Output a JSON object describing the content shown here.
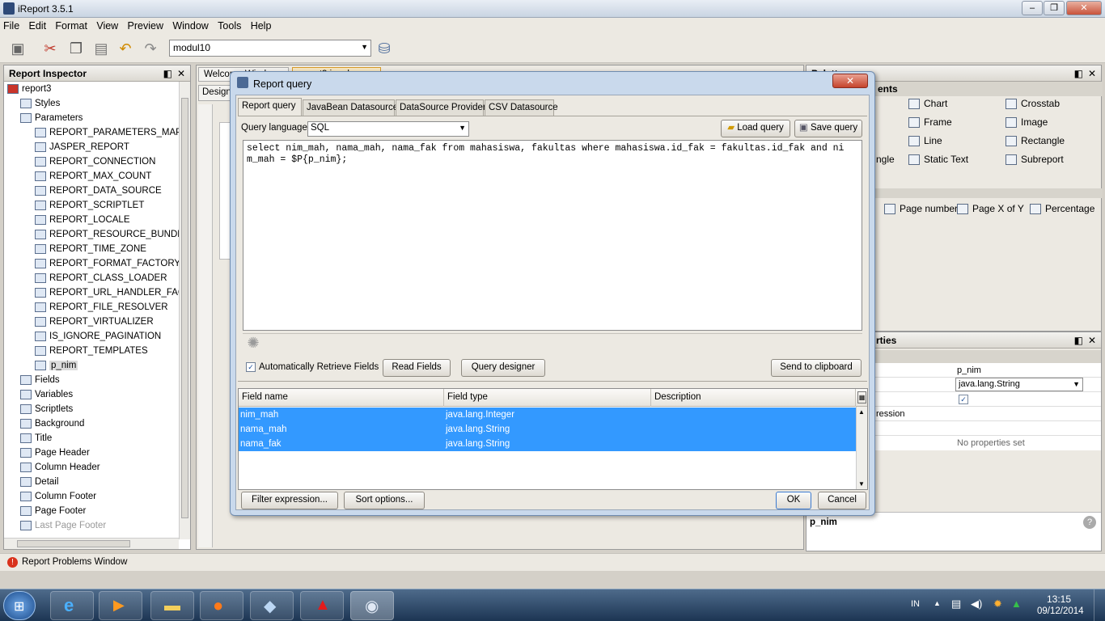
{
  "window": {
    "title": "iReport 3.5.1",
    "min_icon": "minimize-icon",
    "max_icon": "maximize-icon",
    "close_label": "✕"
  },
  "menu": [
    "File",
    "Edit",
    "Format",
    "View",
    "Preview",
    "Window",
    "Tools",
    "Help"
  ],
  "toolbar": {
    "connection": "modul10"
  },
  "inspector": {
    "title": "Report Inspector",
    "root": "report3",
    "items": [
      "Styles",
      "Parameters"
    ],
    "params": [
      "REPORT_PARAMETERS_MAP",
      "JASPER_REPORT",
      "REPORT_CONNECTION",
      "REPORT_MAX_COUNT",
      "REPORT_DATA_SOURCE",
      "REPORT_SCRIPTLET",
      "REPORT_LOCALE",
      "REPORT_RESOURCE_BUNDLE",
      "REPORT_TIME_ZONE",
      "REPORT_FORMAT_FACTORY",
      "REPORT_CLASS_LOADER",
      "REPORT_URL_HANDLER_FACTO",
      "REPORT_FILE_RESOLVER",
      "REPORT_VIRTUALIZER",
      "IS_IGNORE_PAGINATION",
      "REPORT_TEMPLATES",
      "p_nim"
    ],
    "sections": [
      "Fields",
      "Variables",
      "Scriptlets",
      "Background",
      "Title",
      "Page Header",
      "Column Header",
      "Detail",
      "Column Footer",
      "Page Footer",
      "Last Page Footer"
    ]
  },
  "editor": {
    "tab_welcome": "Welcome Window",
    "tab_report": "report3.jrxml",
    "design_tab": "Design"
  },
  "palette": {
    "title": "Palette",
    "section": "ents",
    "items": [
      "Chart",
      "Crosstab",
      "Frame",
      "Image",
      "Line",
      "Rectangle",
      "ngle",
      "Static Text",
      "Subreport",
      "Page number",
      "Page X of Y",
      "Percentage"
    ]
  },
  "properties": {
    "title": "rties",
    "name_value": "p_nim",
    "class_value": "java.lang.String",
    "expr_label": "ression",
    "no_props": "No properties set",
    "footer_name": "p_nim"
  },
  "dialog": {
    "title": "Report query",
    "tabs": [
      "Report query",
      "JavaBean Datasource",
      "DataSource Provider",
      "CSV Datasource"
    ],
    "query_language_label": "Query language",
    "query_language": "SQL",
    "load_query": "Load query",
    "save_query": "Save query",
    "query": "select nim_mah, nama_mah, nama_fak from mahasiswa, fakultas where mahasiswa.id_fak = fakultas.id_fak and ni\nm_mah = $P{p_nim};",
    "auto_retrieve": "Automatically Retrieve Fields",
    "read_fields": "Read Fields",
    "query_designer": "Query designer",
    "send_clipboard": "Send to clipboard",
    "columns": [
      "Field name",
      "Field type",
      "Description"
    ],
    "rows": [
      {
        "name": "nim_mah",
        "type": "java.lang.Integer",
        "desc": ""
      },
      {
        "name": "nama_mah",
        "type": "java.lang.String",
        "desc": ""
      },
      {
        "name": "nama_fak",
        "type": "java.lang.String",
        "desc": ""
      }
    ],
    "filter": "Filter expression...",
    "sort": "Sort options...",
    "ok": "OK",
    "cancel": "Cancel"
  },
  "status": {
    "problems": "Report Problems Window"
  },
  "tray": {
    "lang": "IN",
    "time": "13:15",
    "date": "09/12/2014"
  }
}
